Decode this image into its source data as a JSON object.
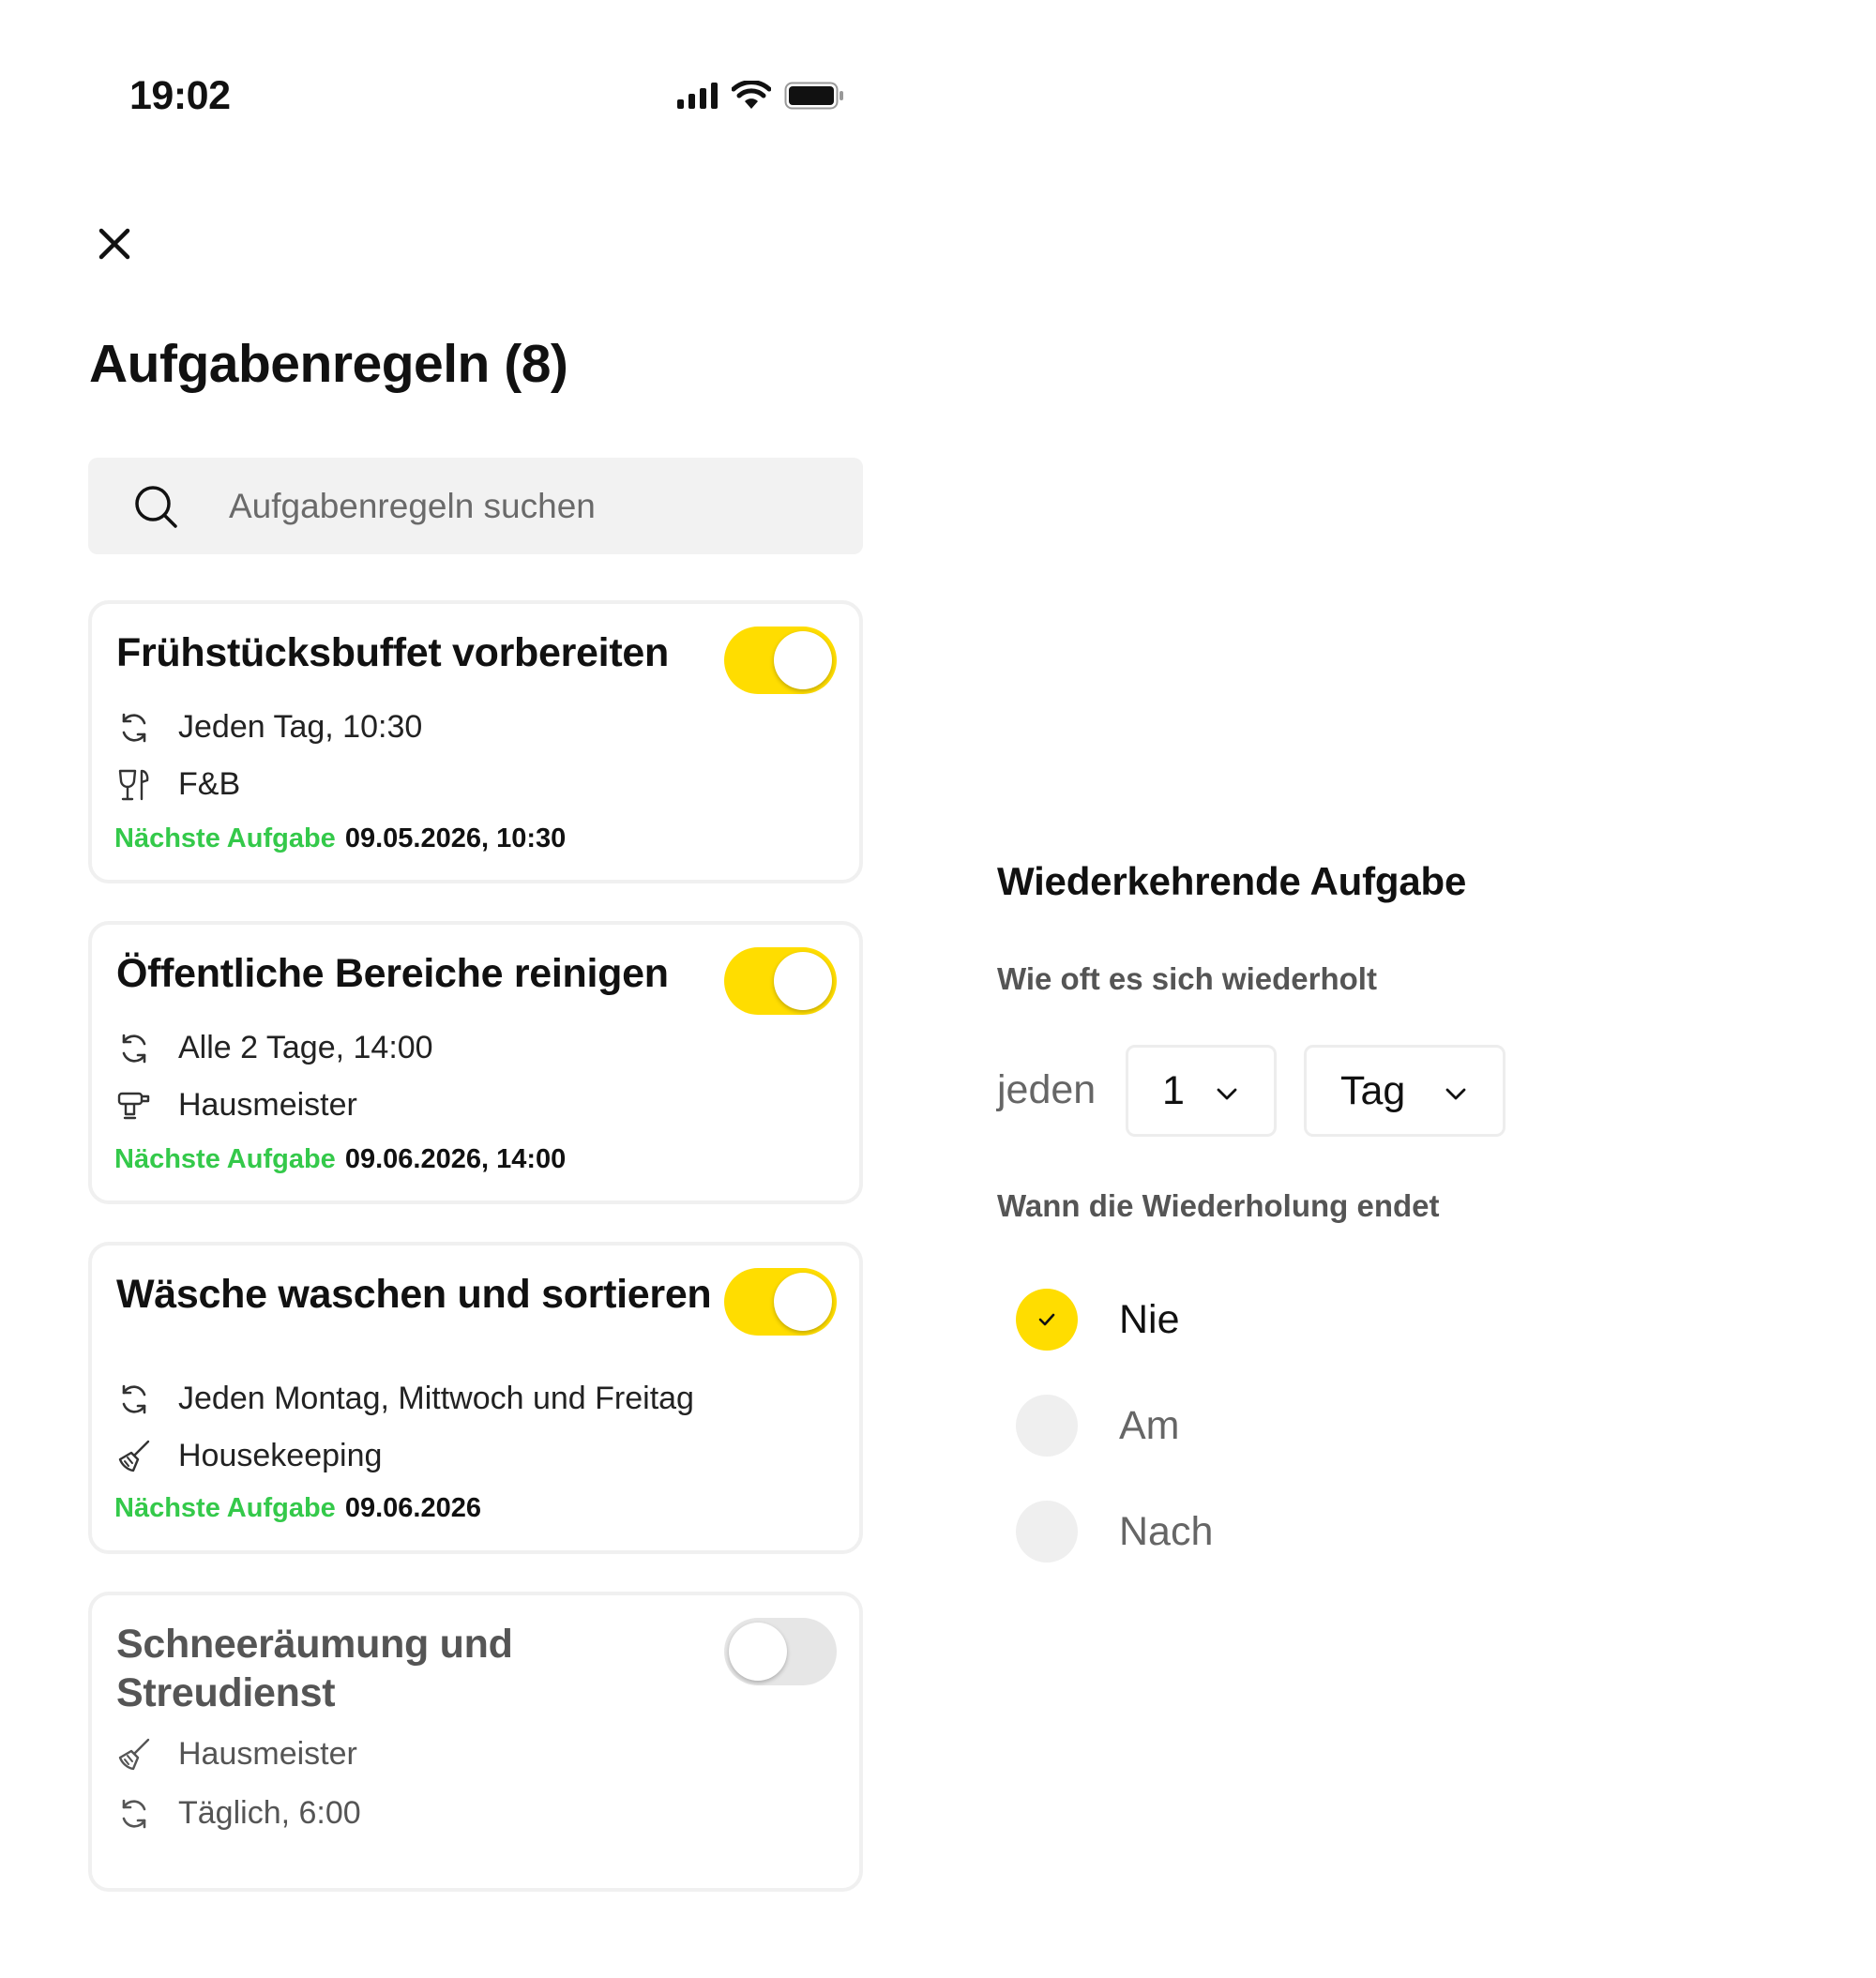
{
  "status_bar": {
    "time": "19:02",
    "icons": [
      "signal-icon",
      "wifi-icon",
      "battery-icon"
    ]
  },
  "header": {
    "close_icon": "close-icon",
    "title": "Aufgabenregeln (8)"
  },
  "search": {
    "placeholder": "Aufgabenregeln suchen",
    "value": ""
  },
  "rules": [
    {
      "title": "Frühstücksbuffet vorbereiten",
      "enabled": true,
      "schedule": "Jeden Tag, 10:30",
      "department": "F&B",
      "department_icon": "wine-cutlery-icon",
      "next_label": "Nächste Aufgabe",
      "next_value": "09.05.2026, 10:30"
    },
    {
      "title": "Öffentliche Bereiche reinigen",
      "enabled": true,
      "schedule": "Alle 2 Tage, 14:00",
      "department": "Hausmeister",
      "department_icon": "drill-icon",
      "next_label": "Nächste Aufgabe",
      "next_value": "09.06.2026, 14:00"
    },
    {
      "title": "Wäsche waschen und sortieren",
      "enabled": true,
      "schedule": "Jeden Montag, Mittwoch und Freitag",
      "department": "Housekeeping",
      "department_icon": "broom-icon",
      "next_label": "Nächste Aufgabe",
      "next_value": "09.06.2026"
    },
    {
      "title": "Schneeräumung und Streudienst",
      "enabled": false,
      "department": "Hausmeister",
      "department_icon": "broom-icon",
      "schedule": "Täglich, 6:00"
    }
  ],
  "recurrence": {
    "title": "Wiederkehrende Aufgabe",
    "frequency_label": "Wie oft es sich wiederholt",
    "every_label": "jeden",
    "interval_value": "1",
    "unit_value": "Tag",
    "end_label": "Wann die Wiederholung endet",
    "end_options": [
      {
        "label": "Nie",
        "selected": true
      },
      {
        "label": "Am",
        "selected": false
      },
      {
        "label": "Nach",
        "selected": false
      }
    ]
  },
  "colors": {
    "accent": "#ffdd00",
    "next_label": "#34c94a",
    "card_border": "#f0f0f0",
    "search_bg": "#f2f2f2"
  }
}
